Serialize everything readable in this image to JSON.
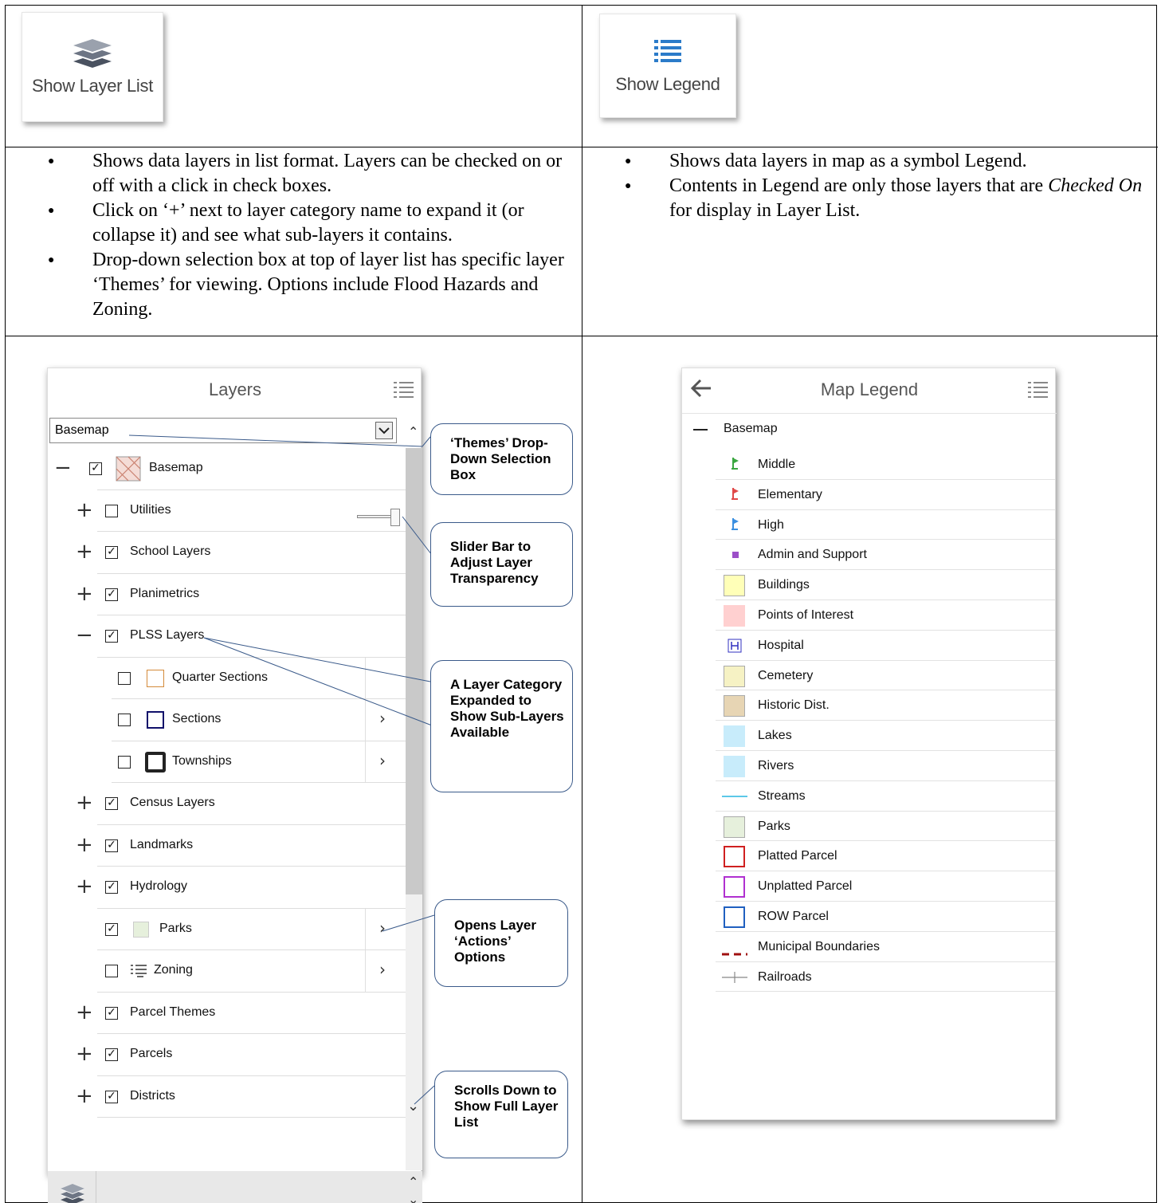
{
  "top_buttons": {
    "layer_list_label": "Show Layer List",
    "legend_label": "Show Legend"
  },
  "left_bullets": [
    "Shows data layers in list format. Layers can be checked on or off with a click in check boxes.",
    "Click on ‘+’ next to layer category name to expand it (or collapse it) and see what sub-layers it contains.",
    "Drop-down selection box at top of layer list has specific layer ‘Themes’ for viewing.  Options include Flood Hazards and Zoning."
  ],
  "right_bullets": {
    "b1": "Shows data layers in map as a symbol Legend.",
    "b2_pre": "Contents in Legend are only those layers that are ",
    "b2_em": "Checked On",
    "b2_post": " for display in Layer List."
  },
  "layers_panel": {
    "title": "Layers",
    "theme_select_value": "Basemap",
    "rows": [
      {
        "label": "Basemap",
        "checked": true,
        "toggle": "−"
      },
      {
        "label": "Utilities",
        "checked": false,
        "toggle": "+"
      },
      {
        "label": "School Layers",
        "checked": true,
        "toggle": "+"
      },
      {
        "label": "Planimetrics",
        "checked": true,
        "toggle": "+"
      },
      {
        "label": "PLSS Layers",
        "checked": true,
        "toggle": "−"
      },
      {
        "label": "Quarter Sections",
        "checked": false
      },
      {
        "label": "Sections",
        "checked": false
      },
      {
        "label": "Townships",
        "checked": false
      },
      {
        "label": "Census Layers",
        "checked": true,
        "toggle": "+"
      },
      {
        "label": "Landmarks",
        "checked": true,
        "toggle": "+"
      },
      {
        "label": "Hydrology",
        "checked": true,
        "toggle": "+"
      },
      {
        "label": "Parks",
        "checked": true
      },
      {
        "label": "Zoning",
        "checked": false
      },
      {
        "label": "Parcel Themes",
        "checked": true,
        "toggle": "+"
      },
      {
        "label": "Parcels",
        "checked": true,
        "toggle": "+"
      },
      {
        "label": "Districts",
        "checked": true,
        "toggle": "+"
      }
    ]
  },
  "callouts": {
    "themes": "‘Themes’ Drop-Down Selection Box",
    "slider": "Slider Bar to Adjust Layer Transparency",
    "expanded": "A Layer Category Expanded to Show Sub-Layers Available",
    "actions": "Opens Layer ‘Actions’ Options",
    "scroll": "Scrolls Down to Show Full Layer List"
  },
  "legend_panel": {
    "title": "Map Legend",
    "group": "Basemap",
    "items": [
      {
        "label": "Middle",
        "symbol": "flag",
        "color": "#3aa640"
      },
      {
        "label": "Elementary",
        "symbol": "flag",
        "color": "#e04848"
      },
      {
        "label": "High",
        "symbol": "flag",
        "color": "#3b8fe0"
      },
      {
        "label": "Admin and Support",
        "symbol": "square",
        "color": "#9c4fc8"
      },
      {
        "label": "Buildings",
        "symbol": "box",
        "color": "#ffffb8"
      },
      {
        "label": "Points of Interest",
        "symbol": "box",
        "color": "#ffd0d0"
      },
      {
        "label": "Hospital",
        "symbol": "hospital",
        "color": "#3030c0"
      },
      {
        "label": "Cemetery",
        "symbol": "box",
        "color": "#f6f2c4"
      },
      {
        "label": "Historic Dist.",
        "symbol": "box",
        "color": "#e7d5b4"
      },
      {
        "label": "Lakes",
        "symbol": "box",
        "color": "#c8ecfb"
      },
      {
        "label": "Rivers",
        "symbol": "box",
        "color": "#c8ecfb"
      },
      {
        "label": "Streams",
        "symbol": "line",
        "color": "#5cc8e8"
      },
      {
        "label": "Parks",
        "symbol": "box",
        "color": "#e6f0dc"
      },
      {
        "label": "Platted Parcel",
        "symbol": "outline",
        "color": "#d02020"
      },
      {
        "label": "Unplatted Parcel",
        "symbol": "outline",
        "color": "#b030d0"
      },
      {
        "label": "ROW Parcel",
        "symbol": "outline",
        "color": "#2060c0"
      },
      {
        "label": "Municipal Boundaries",
        "symbol": "dash",
        "color": "#a01010"
      },
      {
        "label": "Railroads",
        "symbol": "rail",
        "color": "#888888"
      }
    ]
  }
}
